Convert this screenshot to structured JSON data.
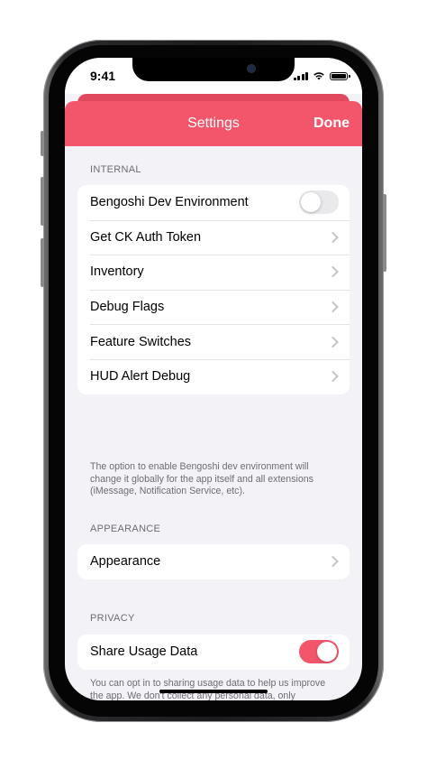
{
  "status_bar": {
    "time": "9:41"
  },
  "nav": {
    "title": "Settings",
    "done_label": "Done"
  },
  "colors": {
    "accent": "#f3566b",
    "background": "#f2f2f7"
  },
  "sections": {
    "internal": {
      "header": "INTERNAL",
      "items": [
        {
          "label": "Bengoshi Dev Environment",
          "control": "toggle",
          "on": false
        },
        {
          "label": "Get CK Auth Token",
          "control": "chevron"
        },
        {
          "label": "Inventory",
          "control": "chevron"
        },
        {
          "label": "Debug Flags",
          "control": "chevron"
        },
        {
          "label": "Feature Switches",
          "control": "chevron"
        },
        {
          "label": "HUD Alert Debug",
          "control": "chevron"
        }
      ],
      "footer": "The option to enable Bengoshi dev environment will change it globally for the app itself and all extensions (iMessage, Notification Service, etc)."
    },
    "appearance": {
      "header": "APPEARANCE",
      "items": [
        {
          "label": "Appearance",
          "control": "chevron"
        }
      ]
    },
    "privacy": {
      "header": "PRIVACY",
      "items": [
        {
          "label": "Share Usage Data",
          "control": "toggle",
          "on": true
        }
      ],
      "footer": "You can opt in to sharing usage data to help us improve the app. We don't collect any personal data, only aggregate data about your usage of the app that can't be traced back to you. This data is not sent to third parties."
    }
  }
}
